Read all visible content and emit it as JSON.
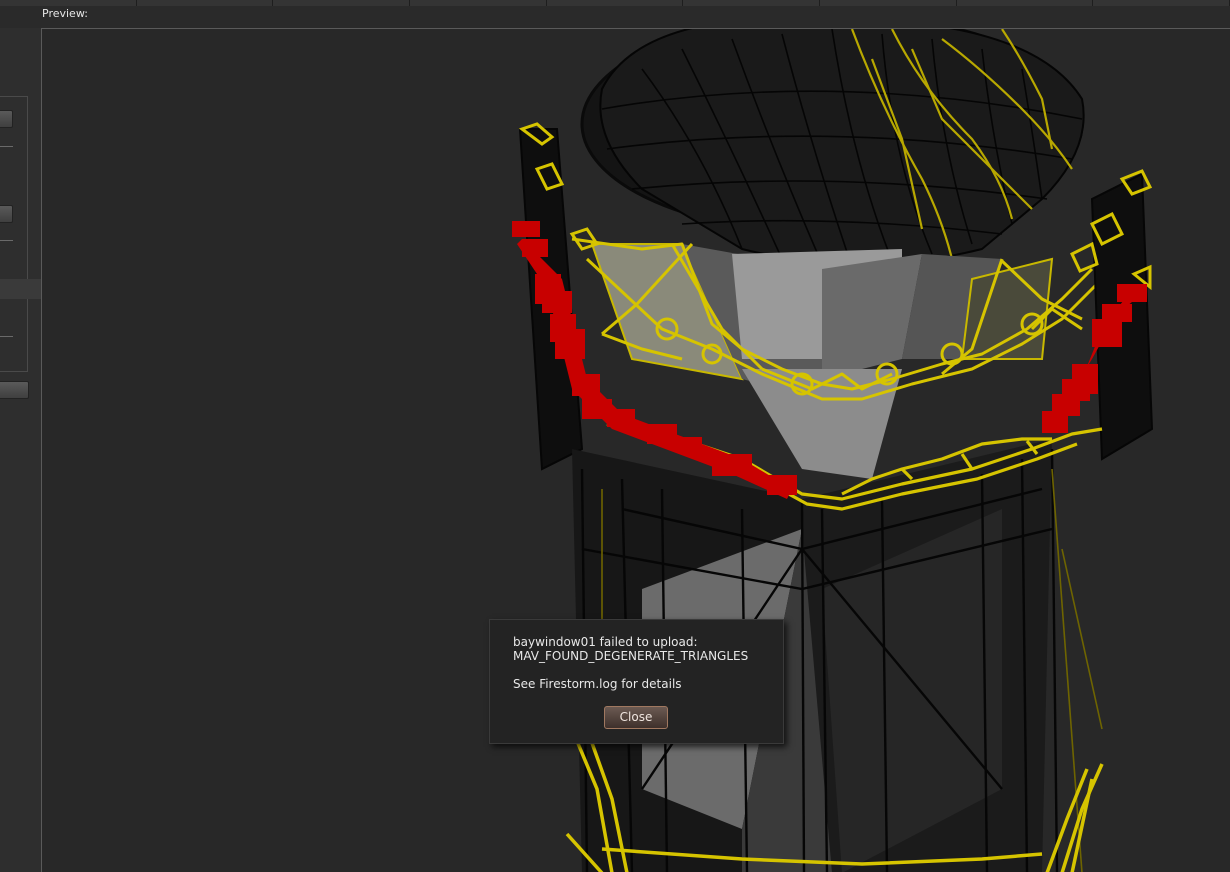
{
  "preview": {
    "label": "Preview:"
  },
  "dialog": {
    "message_line1": "baywindow01 failed to upload:",
    "message_line2": "MAV_FOUND_DEGENERATE_TRIANGLES",
    "details": "See Firestorm.log for details",
    "close_label": "Close"
  },
  "colors": {
    "wire": "#d6c400",
    "wire_dark": "#6e6400",
    "degenerate": "#c80000",
    "solid_dark": "#0c0c0c",
    "solid_grey": "#7a7a7a"
  }
}
